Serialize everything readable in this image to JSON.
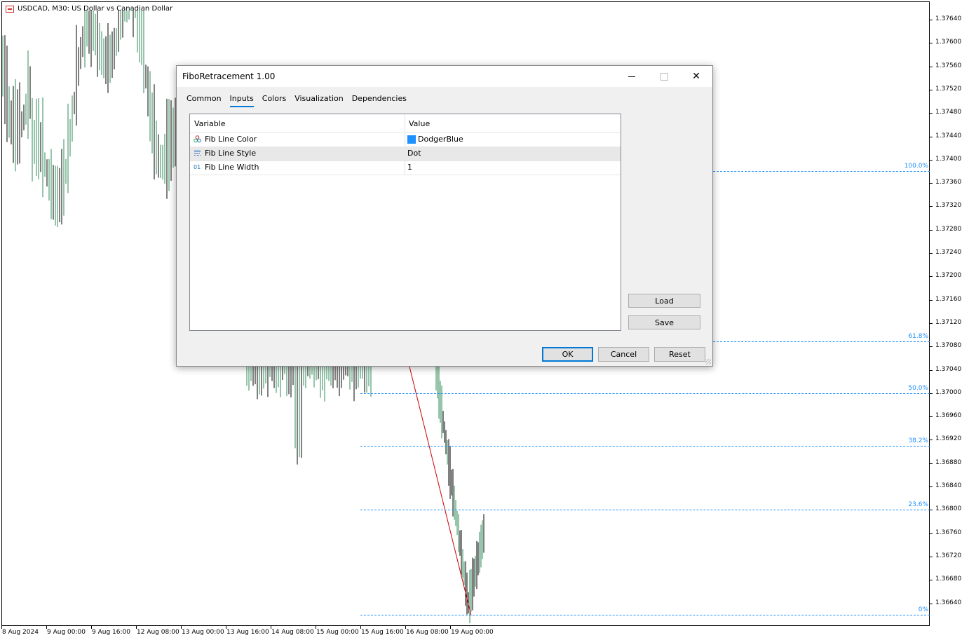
{
  "chart": {
    "title": "USDCAD, M30:  US Dollar vs Canadian Dollar",
    "price_labels": [
      "1.37640",
      "1.37600",
      "1.37560",
      "1.37520",
      "1.37480",
      "1.37440",
      "1.37400",
      "1.37360",
      "1.37320",
      "1.37280",
      "1.37240",
      "1.37200",
      "1.37160",
      "1.37120",
      "1.37080",
      "1.37040",
      "1.37000",
      "1.36960",
      "1.36920",
      "1.36880",
      "1.36840",
      "1.36800",
      "1.36760",
      "1.36720",
      "1.36680",
      "1.36640"
    ],
    "time_labels": [
      "8 Aug 2024",
      "9 Aug 00:00",
      "9 Aug 16:00",
      "12 Aug 08:00",
      "13 Aug 00:00",
      "13 Aug 16:00",
      "14 Aug 08:00",
      "15 Aug 00:00",
      "15 Aug 16:00",
      "16 Aug 08:00",
      "19 Aug 00:00"
    ],
    "fib_levels": [
      {
        "label": "100.0%",
        "price": 1.3738
      },
      {
        "label": "61.8%",
        "price": 1.37089
      },
      {
        "label": "50.0%",
        "price": 1.37
      },
      {
        "label": "38.2%",
        "price": 1.3691
      },
      {
        "label": "23.6%",
        "price": 1.368
      },
      {
        "label": "0%",
        "price": 1.3662
      }
    ],
    "fib_color": "#1e90ff",
    "trend_line_color": "#cc0000",
    "bull_color": "#2e8b57",
    "bear_color": "#000000"
  },
  "dialog": {
    "title": "FiboRetracement 1.00",
    "tabs": [
      "Common",
      "Inputs",
      "Colors",
      "Visualization",
      "Dependencies"
    ],
    "active_tab": "Inputs",
    "table": {
      "col_variable": "Variable",
      "col_value": "Value",
      "rows": [
        {
          "icon": "palette-icon",
          "variable": "Fib Line Color",
          "value": "DodgerBlue",
          "swatch": "#1e90ff"
        },
        {
          "icon": "line-style-icon",
          "variable": "Fib Line Style",
          "value": "Dot"
        },
        {
          "icon": "integer-icon",
          "variable": "Fib Line Width",
          "value": "1"
        }
      ]
    },
    "buttons": {
      "load": "Load",
      "save": "Save",
      "ok": "OK",
      "cancel": "Cancel",
      "reset": "Reset"
    }
  }
}
